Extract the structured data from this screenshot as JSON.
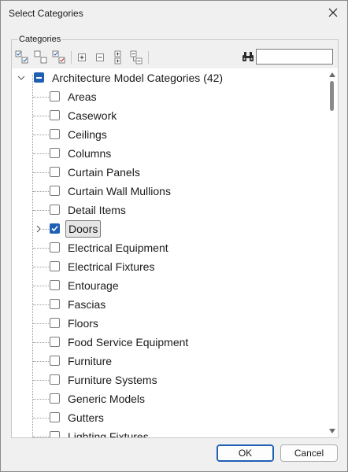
{
  "window": {
    "title": "Select Categories"
  },
  "group": {
    "label": "Categories"
  },
  "toolbar": {
    "buttons": [
      {
        "icon": "check-all-icon"
      },
      {
        "icon": "check-none-icon"
      },
      {
        "icon": "invert-check-icon"
      },
      {
        "icon": "expand-icon"
      },
      {
        "icon": "collapse-icon"
      },
      {
        "icon": "expand-all-icon"
      },
      {
        "icon": "collapse-all-icon"
      }
    ],
    "search_icon": "binoculars-icon",
    "search_value": ""
  },
  "tree": {
    "root": {
      "label": "Architecture Model Categories (42)",
      "state": "partial",
      "expanded": true
    },
    "items": [
      {
        "label": "Areas",
        "checked": false
      },
      {
        "label": "Casework",
        "checked": false
      },
      {
        "label": "Ceilings",
        "checked": false
      },
      {
        "label": "Columns",
        "checked": false
      },
      {
        "label": "Curtain Panels",
        "checked": false
      },
      {
        "label": "Curtain Wall Mullions",
        "checked": false
      },
      {
        "label": "Detail Items",
        "checked": false
      },
      {
        "label": "Doors",
        "checked": true,
        "selected": true,
        "has_children": true
      },
      {
        "label": "Electrical Equipment",
        "checked": false
      },
      {
        "label": "Electrical Fixtures",
        "checked": false
      },
      {
        "label": "Entourage",
        "checked": false
      },
      {
        "label": "Fascias",
        "checked": false
      },
      {
        "label": "Floors",
        "checked": false
      },
      {
        "label": "Food Service Equipment",
        "checked": false
      },
      {
        "label": "Furniture",
        "checked": false
      },
      {
        "label": "Furniture Systems",
        "checked": false
      },
      {
        "label": "Generic Models",
        "checked": false
      },
      {
        "label": "Gutters",
        "checked": false
      },
      {
        "label": "Lighting Fixtures",
        "checked": false
      }
    ]
  },
  "buttons": {
    "ok": "OK",
    "cancel": "Cancel"
  },
  "colors": {
    "accent": "#1f5fb4",
    "background": "#f0f0f0"
  }
}
